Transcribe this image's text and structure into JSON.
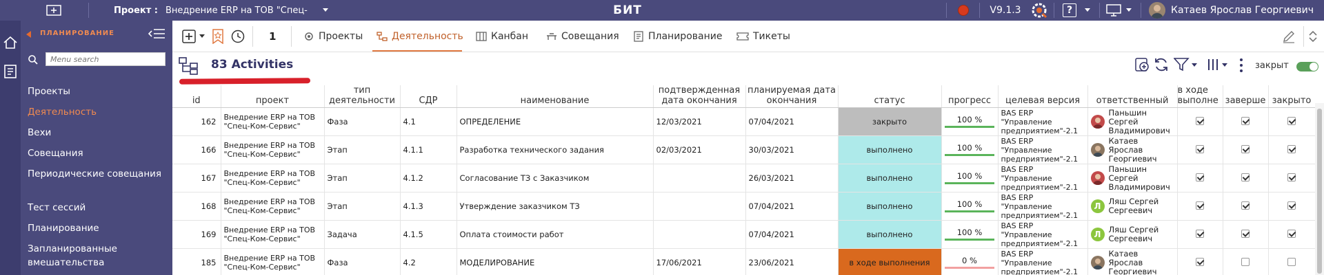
{
  "topbar": {
    "project_label": "Проект :",
    "project_name": "Внедрение ERP на ТОВ \"Спец-Ко",
    "app_title": "БИТ",
    "version": "V9.1.3",
    "help": "?",
    "user_name": "Катаев Ярослав Георгиевич"
  },
  "sidebar": {
    "section_title": "ПЛАНИРОВАНИЕ",
    "search_placeholder": "Menu search",
    "items": [
      {
        "label": "Проекты"
      },
      {
        "label": "Деятельность"
      },
      {
        "label": "Вехи"
      },
      {
        "label": "Совещания"
      },
      {
        "label": "Периодические совещания"
      },
      {
        "label": "Тест сессий"
      },
      {
        "label": "Планирование"
      },
      {
        "label": "Запланированные вмешательства"
      }
    ]
  },
  "toolbar": {
    "counter": "1",
    "tabs": [
      {
        "label": "Проекты"
      },
      {
        "label": "Деятельность"
      },
      {
        "label": "Канбан"
      },
      {
        "label": "Совещания"
      },
      {
        "label": "Планирование"
      },
      {
        "label": "Тикеты"
      }
    ]
  },
  "content": {
    "count_title": "83 Activities",
    "closed_toggle_label": "закрыт",
    "closed_toggle_on": true
  },
  "table": {
    "headers": {
      "id": "id",
      "project": "проект",
      "type": "тип деятельности",
      "wbs": "СДР",
      "name": "наименование",
      "confirmed_end": "подтвержденная дата окончания",
      "planned_end": "планируемая дата окончания",
      "status": "статус",
      "progress": "прогресс",
      "target_version": "целевая версия",
      "responsible": "ответственный",
      "in_progress": "в ходе выполне",
      "done": "заверше",
      "closed": "закрыто"
    },
    "rows": [
      {
        "id": "162",
        "project": "Внедрение ERP на ТОВ \"Спец-Ком-Сервис\"",
        "type": "Фаза",
        "wbs": "4.1",
        "name": "ОПРЕДЕЛЕНИЕ",
        "confirmed_end": "12/03/2021",
        "planned_end": "07/04/2021",
        "status": "закрыто",
        "status_color": "#bdbdbd",
        "progress": "100 %",
        "progress_value": 100,
        "target_version": "BAS ERP \"Управление предприятием\"-2.1",
        "responsible": "Паньшин Сергей Владимирович",
        "avatar": "photo-red",
        "in_progress": true,
        "done": true,
        "closed": true
      },
      {
        "id": "166",
        "project": "Внедрение ERP на ТОВ \"Спец-Ком-Сервис\"",
        "type": "Этап",
        "wbs": "4.1.1",
        "name": "Разработка технического задания",
        "confirmed_end": "02/03/2021",
        "planned_end": "30/03/2021",
        "status": "выполнено",
        "status_color": "#aeeaea",
        "progress": "100 %",
        "progress_value": 100,
        "target_version": "BAS ERP \"Управление предприятием\"-2.1",
        "responsible": "Катаев Ярослав Георгиевич",
        "avatar": "photo-brown",
        "in_progress": true,
        "done": true,
        "closed": true
      },
      {
        "id": "167",
        "project": "Внедрение ERP на ТОВ \"Спец-Ком-Сервис\"",
        "type": "Этап",
        "wbs": "4.1.2",
        "name": "Согласование ТЗ с Заказчиком",
        "confirmed_end": "",
        "planned_end": "26/03/2021",
        "status": "выполнено",
        "status_color": "#aeeaea",
        "progress": "100 %",
        "progress_value": 100,
        "target_version": "BAS ERP \"Управление предприятием\"-2.1",
        "responsible": "Паньшин Сергей Владимирович",
        "avatar": "photo-red",
        "in_progress": true,
        "done": true,
        "closed": true
      },
      {
        "id": "168",
        "project": "Внедрение ERP на ТОВ \"Спец-Ком-Сервис\"",
        "type": "Этап",
        "wbs": "4.1.3",
        "name": "Утверждение заказчиком ТЗ",
        "confirmed_end": "",
        "planned_end": "07/04/2021",
        "status": "выполнено",
        "status_color": "#aeeaea",
        "progress": "100 %",
        "progress_value": 100,
        "target_version": "BAS ERP \"Управление предприятием\"-2.1",
        "responsible": "Ляш Сергей Сергеевич",
        "avatar": "letter-green",
        "avatar_letter": "Л",
        "in_progress": true,
        "done": true,
        "closed": true
      },
      {
        "id": "169",
        "project": "Внедрение ERP на ТОВ \"Спец-Ком-Сервис\"",
        "type": "Задача",
        "wbs": "4.1.5",
        "name": "Оплата стоимости работ",
        "confirmed_end": "",
        "planned_end": "07/04/2021",
        "status": "выполнено",
        "status_color": "#aeeaea",
        "progress": "100 %",
        "progress_value": 100,
        "target_version": "BAS ERP \"Управление предприятием\"-2.1",
        "responsible": "Ляш Сергей Сергеевич",
        "avatar": "letter-green",
        "avatar_letter": "Л",
        "in_progress": true,
        "done": true,
        "closed": true
      },
      {
        "id": "185",
        "project": "Внедрение ERP на ТОВ \"Спец-Ком-Сервис\"",
        "type": "Фаза",
        "wbs": "4.2",
        "name": "МОДЕЛИРОВАНИЕ",
        "confirmed_end": "17/06/2021",
        "planned_end": "23/06/2021",
        "status": "в ходе выполнения",
        "status_color": "#d9691e",
        "progress": "0 %",
        "progress_value": 0,
        "target_version": "BAS ERP \"Управление предприятием\"-2.1",
        "responsible": "Катаев Ярослав Георгиевич",
        "avatar": "photo-brown",
        "in_progress": true,
        "done": false,
        "closed": false
      }
    ]
  },
  "colors": {
    "header_bg": "#4a4a7c",
    "rail_bg": "#3d3d6e",
    "accent_orange": "#e07840",
    "title_navy": "#333366"
  },
  "icons": [
    "home-icon",
    "report-icon",
    "search-icon",
    "menu-collapse-icon",
    "add-icon",
    "bookmark-star-icon",
    "history-icon",
    "projects-icon",
    "activity-icon",
    "kanban-icon",
    "meetings-icon",
    "planning-icon",
    "tickets-icon",
    "edit-icon",
    "chevron-up-icon",
    "chevron-down-icon",
    "hierarchy-icon",
    "add-circle-icon",
    "refresh-icon",
    "filter-icon",
    "columns-icon",
    "more-vertical-icon",
    "gear-logo-icon",
    "monitor-icon"
  ]
}
